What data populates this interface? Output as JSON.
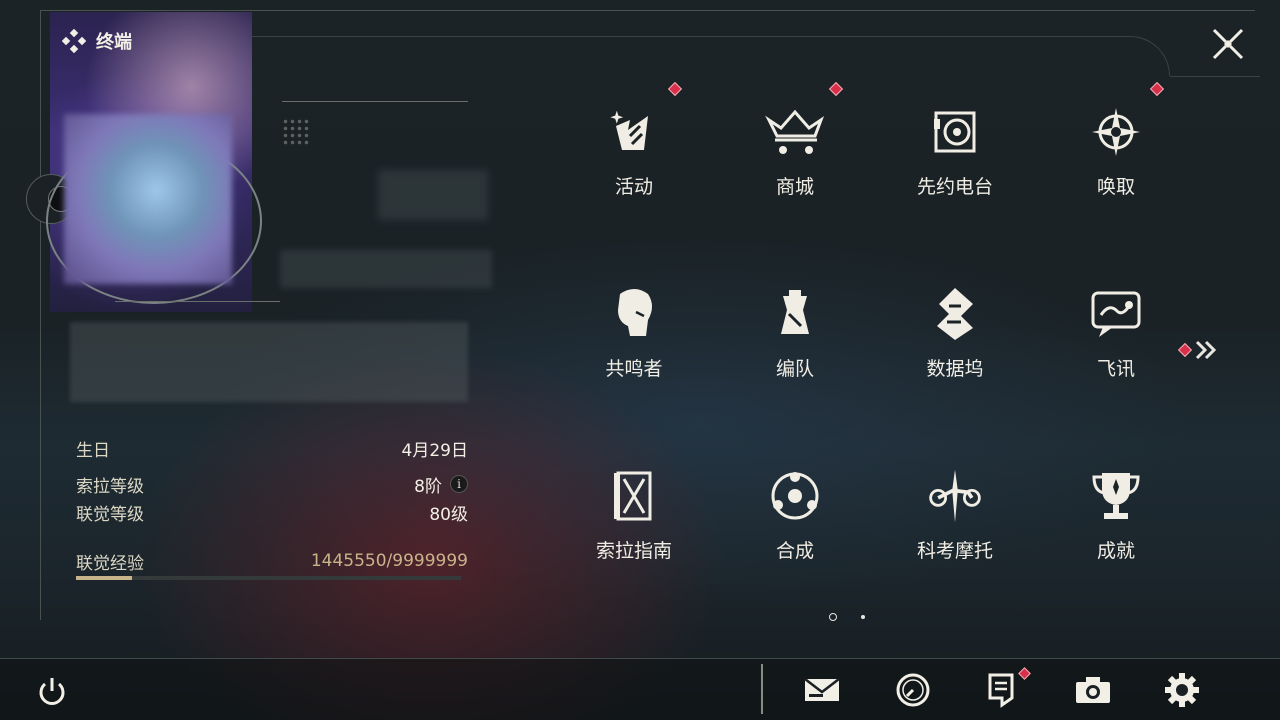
{
  "header": {
    "title": "终端"
  },
  "profile": {
    "birthday_label": "生日",
    "birthday_value": "4月29日",
    "sola_level_label": "索拉等级",
    "sola_level_value": "8阶",
    "union_level_label": "联觉等级",
    "union_level_value": "80级",
    "union_xp_label": "联觉经验",
    "union_xp_value": "1445550/9999999",
    "union_xp_progress": 0.1446
  },
  "menu": [
    {
      "id": "activity",
      "label": "活动",
      "icon": "activity-icon",
      "badge": true
    },
    {
      "id": "shop",
      "label": "商城",
      "icon": "shop-crown-cart-icon",
      "badge": true
    },
    {
      "id": "radio",
      "label": "先约电台",
      "icon": "radio-icon",
      "badge": false
    },
    {
      "id": "convene",
      "label": "唤取",
      "icon": "convene-compass-icon",
      "badge": true
    },
    {
      "id": "resonators",
      "label": "共鸣者",
      "icon": "resonator-head-icon",
      "badge": false
    },
    {
      "id": "team",
      "label": "编队",
      "icon": "team-chess-icon",
      "badge": false
    },
    {
      "id": "databank",
      "label": "数据坞",
      "icon": "databank-icon",
      "badge": false
    },
    {
      "id": "messages",
      "label": "飞讯",
      "icon": "chat-bubble-icon",
      "badge": false
    },
    {
      "id": "guide",
      "label": "索拉指南",
      "icon": "guide-book-icon",
      "badge": false
    },
    {
      "id": "synthesis",
      "label": "合成",
      "icon": "synthesis-icon",
      "badge": false
    },
    {
      "id": "kaktomoto",
      "label": "科考摩托",
      "icon": "motorbike-icon",
      "badge": false
    },
    {
      "id": "achievements",
      "label": "成就",
      "icon": "trophy-icon",
      "badge": false
    }
  ],
  "pagination": {
    "pages": 2,
    "current": 1
  },
  "next_page": {
    "icon": "chevron-double-right-icon",
    "badge": true
  },
  "bottom_bar": [
    {
      "id": "mail",
      "icon": "mail-icon",
      "badge": false
    },
    {
      "id": "timer",
      "icon": "clock-icon",
      "badge": false
    },
    {
      "id": "notes",
      "icon": "notes-icon",
      "badge": true
    },
    {
      "id": "camera",
      "icon": "camera-icon",
      "badge": false
    },
    {
      "id": "settings",
      "icon": "gear-icon",
      "badge": false
    }
  ],
  "colors": {
    "accent": "#c8b48a",
    "badge": "#d8304a",
    "text": "#f0ede4"
  }
}
